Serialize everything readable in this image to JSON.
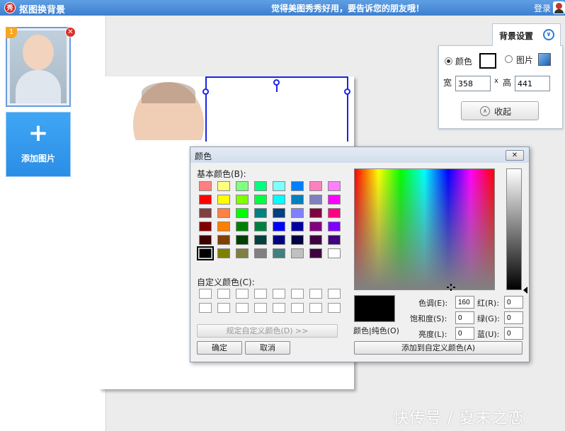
{
  "app": {
    "icon_text": "秀",
    "title": "抠图换背景",
    "slogan": "觉得美图秀秀好用，要告诉您的朋友哦！",
    "login": "登录"
  },
  "sidebar": {
    "thumbnail_number": "1",
    "add_image_label": "添加图片"
  },
  "bg_settings": {
    "tab_label": "背景设置",
    "color_option": "颜色",
    "image_option": "图片",
    "selected_option": "颜色",
    "width_label": "宽",
    "width_value": "358",
    "times": "x",
    "height_label": "高",
    "height_value": "441",
    "collapse_label": "收起",
    "selected_color": "#ffffff"
  },
  "color_dialog": {
    "title": "颜色",
    "basic_colors_label": "基本颜色(B):",
    "basic_colors": [
      [
        "#ff8080",
        "#ffff80",
        "#80ff80",
        "#00ff80",
        "#80ffff",
        "#0080ff",
        "#ff80c0",
        "#ff80ff"
      ],
      [
        "#ff0000",
        "#ffff00",
        "#80ff00",
        "#00ff40",
        "#00ffff",
        "#0080c0",
        "#8080c0",
        "#ff00ff"
      ],
      [
        "#804040",
        "#ff8040",
        "#00ff00",
        "#008080",
        "#004080",
        "#8080ff",
        "#800040",
        "#ff0080"
      ],
      [
        "#800000",
        "#ff8000",
        "#008000",
        "#008040",
        "#0000ff",
        "#0000a0",
        "#800080",
        "#8000ff"
      ],
      [
        "#400000",
        "#804000",
        "#004000",
        "#004040",
        "#000080",
        "#000040",
        "#400040",
        "#400080"
      ],
      [
        "#000000",
        "#808000",
        "#808040",
        "#808080",
        "#408080",
        "#c0c0c0",
        "#400040",
        "#ffffff"
      ]
    ],
    "selected_basic": [
      5,
      0
    ],
    "custom_colors_label": "自定义颜色(C):",
    "define_custom_button": "规定自定义颜色(D) >>",
    "ok_button": "确定",
    "cancel_button": "取消",
    "preview_label": "颜色|纯色(O)",
    "hue_label": "色调(E):",
    "hue_value": "160",
    "sat_label": "饱和度(S):",
    "sat_value": "0",
    "lum_label": "亮度(L):",
    "lum_value": "0",
    "red_label": "红(R):",
    "red_value": "0",
    "green_label": "绿(G):",
    "green_value": "0",
    "blue_label": "蓝(U):",
    "blue_value": "0",
    "add_custom_button": "添加到自定义颜色(A)",
    "current_color": "#000000"
  },
  "watermark": "快传号 / 夏末之恋"
}
